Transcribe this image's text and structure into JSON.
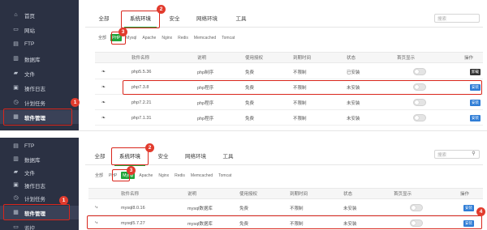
{
  "panel1": {
    "sidebar": [
      {
        "label": "首页",
        "icon": "home-icon",
        "glyph": "⌂"
      },
      {
        "label": "网站",
        "icon": "monitor-icon",
        "glyph": "▭"
      },
      {
        "label": "FTP",
        "icon": "ftp-icon",
        "glyph": "▤"
      },
      {
        "label": "数据库",
        "icon": "database-icon",
        "glyph": "▥"
      },
      {
        "label": "文件",
        "icon": "folder-icon",
        "glyph": "▰"
      },
      {
        "label": "操作日志",
        "icon": "log-icon",
        "glyph": "▣"
      },
      {
        "label": "计划任务",
        "icon": "clock-icon",
        "glyph": "◷"
      },
      {
        "label": "软件管理",
        "icon": "software-icon",
        "glyph": "▦"
      }
    ],
    "tabs": [
      "全部",
      "系统环境",
      "安全",
      "网络环境",
      "工具"
    ],
    "search_placeholder": "搜索",
    "filters": [
      "全部",
      "PHP",
      "Mysql",
      "Apache",
      "Nginx",
      "Redis",
      "Memcached",
      "Tomcat"
    ],
    "columns": [
      "软件名称",
      "说明",
      "使用授权",
      "到期时间",
      "状态",
      "首页显示",
      "操作"
    ],
    "rows": [
      {
        "name": "php5.5.36",
        "desc": "php制序",
        "license": "免费",
        "expiry": "不限制",
        "status": "已安装",
        "op": "卸载"
      },
      {
        "name": "php7.3.8",
        "desc": "php程序",
        "license": "免费",
        "expiry": "不限制",
        "status": "未安装",
        "op": "安装"
      },
      {
        "name": "php7.2.21",
        "desc": "php程序",
        "license": "免费",
        "expiry": "不限制",
        "status": "未安装",
        "op": "安装"
      },
      {
        "name": "php7.1.31",
        "desc": "php程序",
        "license": "免费",
        "expiry": "不限制",
        "status": "未安装",
        "op": "安装"
      }
    ],
    "badges": [
      "1",
      "2",
      "3"
    ]
  },
  "panel2": {
    "sidebar": [
      {
        "label": "FTP",
        "icon": "ftp-icon",
        "glyph": "▤"
      },
      {
        "label": "数据库",
        "icon": "database-icon",
        "glyph": "▥"
      },
      {
        "label": "文件",
        "icon": "folder-icon",
        "glyph": "▰"
      },
      {
        "label": "操作日志",
        "icon": "log-icon",
        "glyph": "▣"
      },
      {
        "label": "计划任务",
        "icon": "clock-icon",
        "glyph": "◷"
      },
      {
        "label": "软件管理",
        "icon": "software-icon",
        "glyph": "▦"
      },
      {
        "label": "监控",
        "icon": "monitor-icon",
        "glyph": "▭"
      }
    ],
    "tabs": [
      "全部",
      "系统环境",
      "安全",
      "网络环境",
      "工具"
    ],
    "search_placeholder": "搜索",
    "filters": [
      "全部",
      "PHP",
      "Mysql",
      "Apache",
      "Nginx",
      "Redis",
      "Memcached",
      "Tomcat"
    ],
    "columns": [
      "软件名称",
      "说明",
      "使用授权",
      "到期时间",
      "状态",
      "首页显示",
      "操作"
    ],
    "rows": [
      {
        "name": "mysql8.0.16",
        "desc": "mysql数据库",
        "license": "免费",
        "expiry": "不限制",
        "status": "未安装",
        "op": "安装"
      },
      {
        "name": "mysql5.7.27",
        "desc": "mysql数据库",
        "license": "免费",
        "expiry": "不限制",
        "status": "未安装",
        "op": "安装"
      }
    ],
    "badges": [
      "1",
      "2",
      "3",
      "4"
    ]
  },
  "colors": {
    "sidebar_bg": "#2b3143",
    "accent_green": "#20a53a",
    "annotation_red": "#d9261c",
    "install_blue": "#2f7dd6"
  }
}
